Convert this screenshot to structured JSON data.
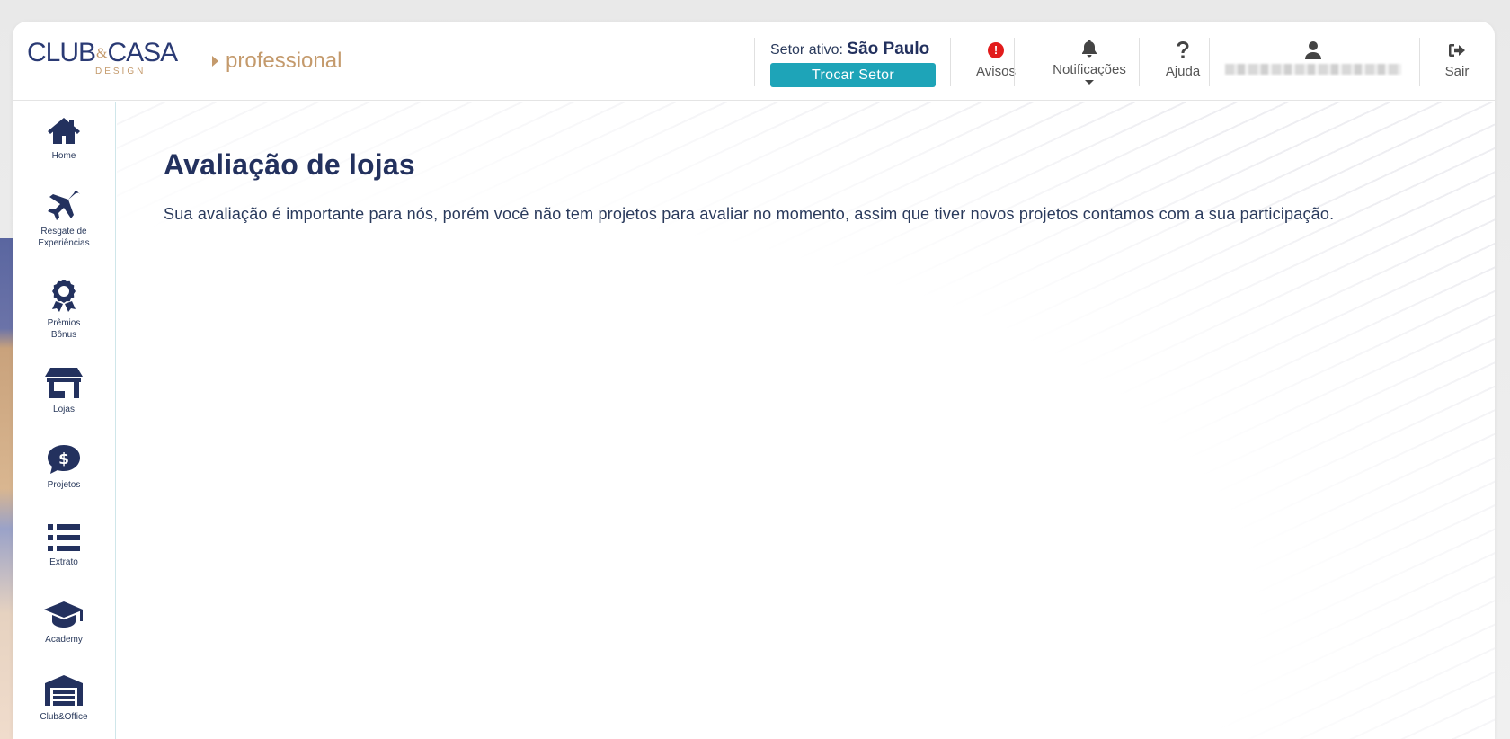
{
  "brand": {
    "logo_main_left": "CLUB",
    "logo_amp": "&",
    "logo_main_right": "CASA",
    "logo_sub": "DESIGN",
    "product": "professional"
  },
  "header": {
    "sector_label": "Setor ativo:",
    "sector_value": "São Paulo",
    "swap_button": "Trocar Setor",
    "alerts_label": "Avisos",
    "alerts_badge": "!",
    "notifications_label": "Notificações",
    "help_label": "Ajuda",
    "logout_label": "Sair"
  },
  "sidebar": {
    "items": [
      {
        "label": "Home",
        "icon": "home-icon"
      },
      {
        "label": "Resgate de Experiências",
        "icon": "plane-icon"
      },
      {
        "label": "Prêmios Bônus",
        "icon": "award-icon"
      },
      {
        "label": "Lojas",
        "icon": "store-icon"
      },
      {
        "label": "Projetos",
        "icon": "dollar-chat-icon"
      },
      {
        "label": "Extrato",
        "icon": "list-icon"
      },
      {
        "label": "Academy",
        "icon": "graduation-cap-icon"
      },
      {
        "label": "Club&Office",
        "icon": "warehouse-icon"
      }
    ]
  },
  "main": {
    "title": "Avaliação de lojas",
    "description": "Sua avaliação é importante para nós, porém você não tem projetos para avaliar no momento, assim que tiver novos projetos contamos com a sua participação."
  },
  "colors": {
    "navy": "#23315e",
    "gold": "#c49a6c",
    "teal": "#1ea4b8",
    "alert_red": "#e21b1b"
  }
}
